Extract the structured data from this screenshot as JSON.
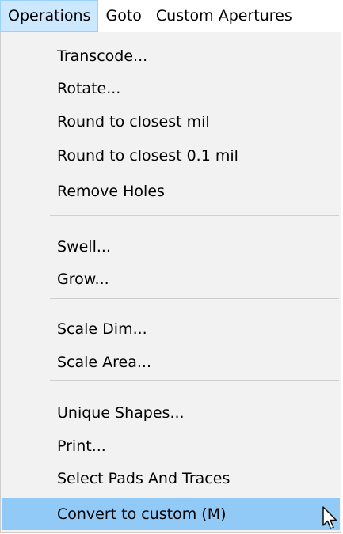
{
  "menubar": {
    "items": [
      {
        "label": "Operations",
        "active": true
      },
      {
        "label": "Goto",
        "active": false
      },
      {
        "label": "Custom Apertures",
        "active": false
      }
    ]
  },
  "menu": {
    "items": [
      {
        "label": "Transcode..."
      },
      {
        "label": "Rotate..."
      },
      {
        "label": "Round to closest mil"
      },
      {
        "label": "Round to closest 0.1 mil"
      },
      {
        "label": "Remove Holes"
      },
      {
        "label": "Swell..."
      },
      {
        "label": "Grow..."
      },
      {
        "label": "Scale Dim..."
      },
      {
        "label": "Scale Area..."
      },
      {
        "label": "Unique Shapes..."
      },
      {
        "label": "Print..."
      },
      {
        "label": "Select Pads And Traces"
      },
      {
        "label": "Convert to custom (M)"
      }
    ]
  },
  "colors": {
    "menubar_active_bg": "#cce8ff",
    "menu_bg": "#f2f2f2",
    "highlight_bg": "#91c9f7"
  },
  "icons": {
    "cursor": "mouse-pointer-icon"
  }
}
